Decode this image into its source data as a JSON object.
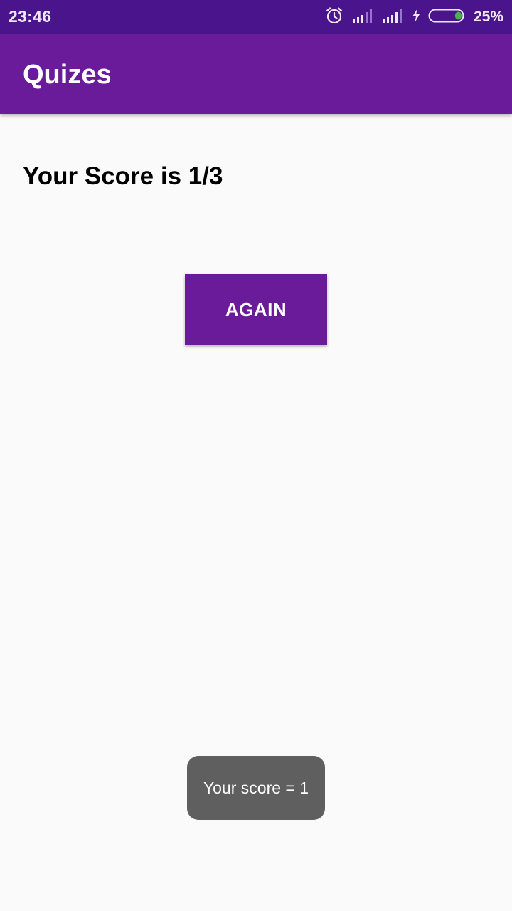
{
  "status_bar": {
    "time": "23:46",
    "battery_percent": "25%",
    "battery_level": 0.25,
    "icons": [
      "alarm-icon",
      "signal-icon",
      "signal-icon",
      "charging-icon",
      "battery-icon"
    ]
  },
  "app_bar": {
    "title": "Quizes"
  },
  "main": {
    "score_text": "Your Score is 1/3",
    "again_label": "AGAIN"
  },
  "toast": {
    "message": "Your score = 1"
  },
  "colors": {
    "status_bar": "#4a148c",
    "primary": "#6a1b9a",
    "background": "#fafafa",
    "toast_bg": "#5f5f5f",
    "battery_fill": "#4caf50"
  }
}
